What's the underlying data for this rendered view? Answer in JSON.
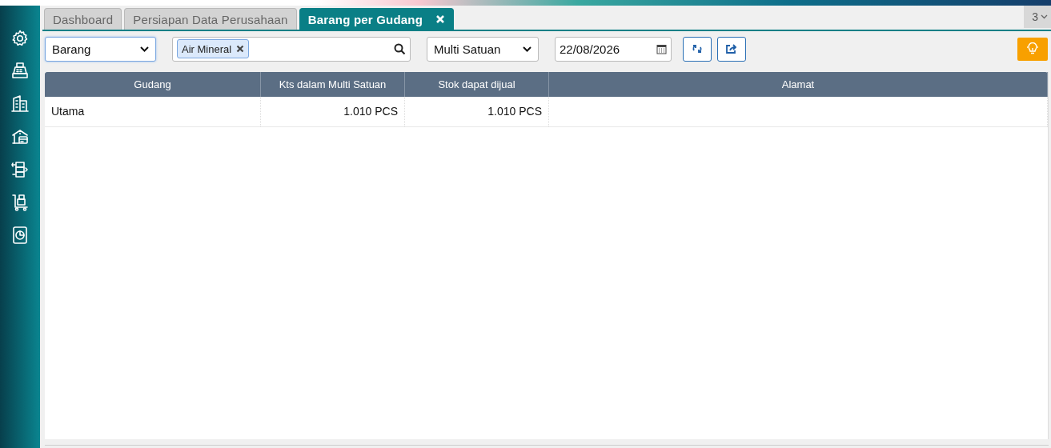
{
  "tabs": [
    {
      "label": "Dashboard",
      "selected": false
    },
    {
      "label": "Persiapan Data Perusahaan",
      "selected": false
    },
    {
      "label": "Barang per Gudang",
      "selected": true
    }
  ],
  "tab_count": "3",
  "toolbar": {
    "group_by": "Barang",
    "item_filter": {
      "chips": [
        "Air Mineral"
      ]
    },
    "unit_mode": "Multi Satuan",
    "date": "22/08/2026"
  },
  "table": {
    "columns": [
      {
        "label": "Gudang",
        "kind": "text"
      },
      {
        "label": "Kts dalam Multi Satuan",
        "kind": "number"
      },
      {
        "label": "Stok dapat dijual",
        "kind": "number"
      },
      {
        "label": "Alamat",
        "kind": "text"
      }
    ],
    "rows": [
      {
        "cells": [
          "Utama",
          "1.010 PCS",
          "1.010 PCS",
          ""
        ]
      }
    ]
  }
}
